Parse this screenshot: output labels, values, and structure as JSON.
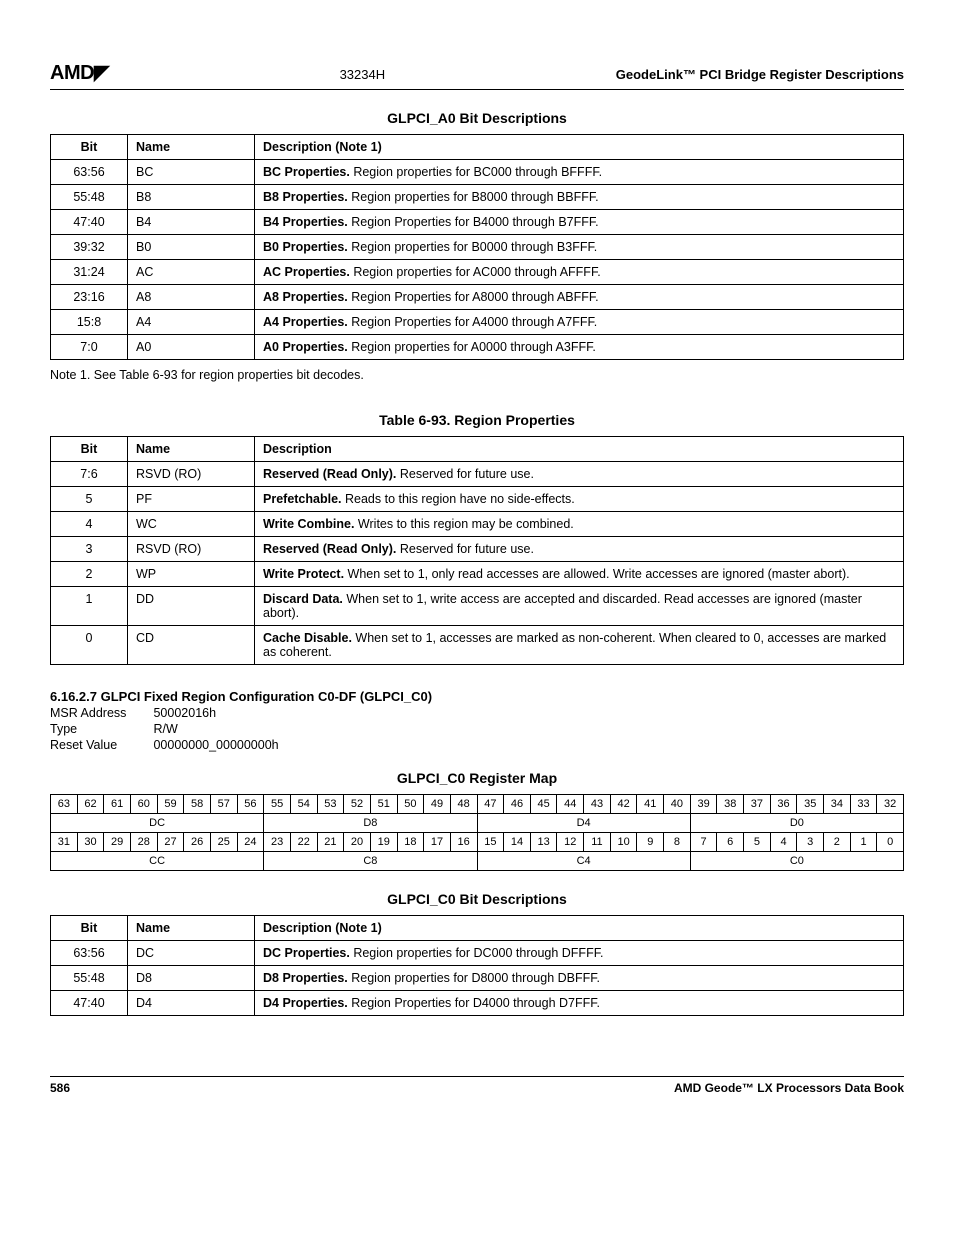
{
  "header": {
    "logo": "AMD",
    "docnum": "33234H",
    "right": "GeodeLink™ PCI Bridge Register Descriptions"
  },
  "glpci_a0": {
    "title": "GLPCI_A0 Bit Descriptions",
    "col_bit": "Bit",
    "col_name": "Name",
    "col_desc": "Description (Note 1)",
    "rows": [
      {
        "bit": "63:56",
        "name": "BC",
        "bold": "BC Properties.",
        "rest": " Region properties for BC000 through BFFFF."
      },
      {
        "bit": "55:48",
        "name": "B8",
        "bold": "B8 Properties.",
        "rest": " Region properties for B8000 through BBFFF."
      },
      {
        "bit": "47:40",
        "name": "B4",
        "bold": "B4 Properties.",
        "rest": " Region Properties for B4000 through B7FFF."
      },
      {
        "bit": "39:32",
        "name": "B0",
        "bold": "B0 Properties.",
        "rest": " Region properties for B0000 through B3FFF."
      },
      {
        "bit": "31:24",
        "name": "AC",
        "bold": "AC Properties.",
        "rest": " Region properties for AC000 through AFFFF."
      },
      {
        "bit": "23:16",
        "name": "A8",
        "bold": "A8 Properties.",
        "rest": " Region Properties for A8000 through ABFFF."
      },
      {
        "bit": "15:8",
        "name": "A4",
        "bold": "A4 Properties.",
        "rest": " Region Properties for A4000 through A7FFF."
      },
      {
        "bit": "7:0",
        "name": "A0",
        "bold": "A0 Properties.",
        "rest": " Region properties for A0000 through A3FFF."
      }
    ],
    "note": "Note 1.   See Table 6-93 for region properties bit decodes."
  },
  "region_props": {
    "title": "Table 6-93.  Region Properties",
    "col_bit": "Bit",
    "col_name": "Name",
    "col_desc": "Description",
    "rows": [
      {
        "bit": "7:6",
        "name": "RSVD (RO)",
        "bold": "Reserved (Read Only).",
        "rest": " Reserved for future use."
      },
      {
        "bit": "5",
        "name": "PF",
        "bold": "Prefetchable.",
        "rest": " Reads to this region have no side-effects."
      },
      {
        "bit": "4",
        "name": "WC",
        "bold": "Write Combine.",
        "rest": " Writes to this region may be combined."
      },
      {
        "bit": "3",
        "name": "RSVD (RO)",
        "bold": "Reserved (Read Only).",
        "rest": " Reserved for future use."
      },
      {
        "bit": "2",
        "name": "WP",
        "bold": "Write Protect.",
        "rest": " When set to 1, only read accesses are allowed. Write accesses are ignored (master abort)."
      },
      {
        "bit": "1",
        "name": "DD",
        "bold": "Discard Data.",
        "rest": " When set to 1, write access are accepted and discarded. Read accesses are ignored (master abort)."
      },
      {
        "bit": "0",
        "name": "CD",
        "bold": "Cache Disable.",
        "rest": " When set to 1, accesses are marked as non-coherent. When cleared to 0, accesses are marked as coherent."
      }
    ]
  },
  "glpci_c0_sect": {
    "heading": "6.16.2.7   GLPCI Fixed Region Configuration C0-DF (GLPCI_C0)",
    "msr_label": "MSR Address",
    "msr_val": "50002016h",
    "type_label": "Type",
    "type_val": "R/W",
    "reset_label": "Reset Value",
    "reset_val": "00000000_00000000h"
  },
  "regmap": {
    "title": "GLPCI_C0 Register Map",
    "bits_hi": [
      "63",
      "62",
      "61",
      "60",
      "59",
      "58",
      "57",
      "56",
      "55",
      "54",
      "53",
      "52",
      "51",
      "50",
      "49",
      "48",
      "47",
      "46",
      "45",
      "44",
      "43",
      "42",
      "41",
      "40",
      "39",
      "38",
      "37",
      "36",
      "35",
      "34",
      "33",
      "32"
    ],
    "names_hi": [
      "DC",
      "D8",
      "D4",
      "D0"
    ],
    "bits_lo": [
      "31",
      "30",
      "29",
      "28",
      "27",
      "26",
      "25",
      "24",
      "23",
      "22",
      "21",
      "20",
      "19",
      "18",
      "17",
      "16",
      "15",
      "14",
      "13",
      "12",
      "11",
      "10",
      "9",
      "8",
      "7",
      "6",
      "5",
      "4",
      "3",
      "2",
      "1",
      "0"
    ],
    "names_lo": [
      "CC",
      "C8",
      "C4",
      "C0"
    ]
  },
  "glpci_c0_bits": {
    "title": "GLPCI_C0 Bit Descriptions",
    "col_bit": "Bit",
    "col_name": "Name",
    "col_desc": "Description (Note 1)",
    "rows": [
      {
        "bit": "63:56",
        "name": "DC",
        "bold": "DC Properties.",
        "rest": " Region properties for DC000 through DFFFF."
      },
      {
        "bit": "55:48",
        "name": "D8",
        "bold": "D8 Properties.",
        "rest": " Region properties for D8000 through DBFFF."
      },
      {
        "bit": "47:40",
        "name": "D4",
        "bold": "D4 Properties.",
        "rest": " Region Properties for D4000 through D7FFF."
      }
    ]
  },
  "footer": {
    "page": "586",
    "book": "AMD Geode™ LX Processors Data Book"
  }
}
